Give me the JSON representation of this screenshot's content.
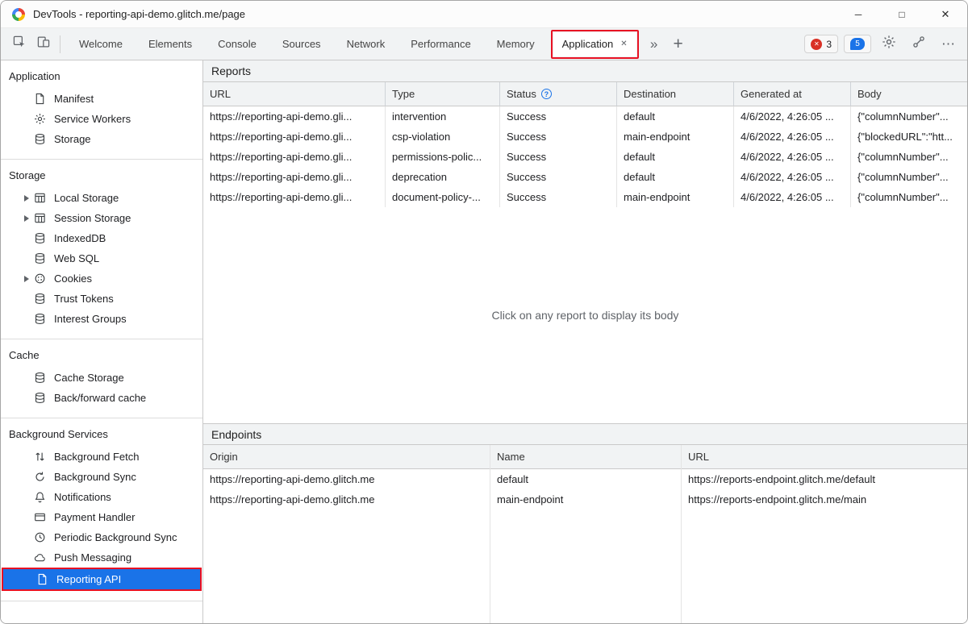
{
  "colors": {
    "selection_blue": "#1a73e8",
    "annotation_red": "#e81123",
    "error_red": "#d93025",
    "issues_blue": "#1a73e8"
  },
  "window": {
    "title": "DevTools - reporting-api-demo.glitch.me/page"
  },
  "toolbar": {
    "tabs": [
      "Welcome",
      "Elements",
      "Console",
      "Sources",
      "Network",
      "Performance",
      "Memory",
      "Application"
    ],
    "active_tab": "Application",
    "error_count": "3",
    "issues_count": "5",
    "icons": [
      "inspect-icon",
      "device-toolbar-icon",
      "overflow-chevron-icon",
      "add-tab-icon",
      "gear-icon",
      "remote-devices-icon",
      "more-menu-icon"
    ]
  },
  "sidebar": {
    "sections": [
      {
        "title": "Application",
        "items": [
          {
            "label": "Manifest",
            "icon": "document-icon"
          },
          {
            "label": "Service Workers",
            "icon": "gear-icon"
          },
          {
            "label": "Storage",
            "icon": "database-icon"
          }
        ]
      },
      {
        "title": "Storage",
        "items": [
          {
            "label": "Local Storage",
            "icon": "table-icon",
            "expandable": true
          },
          {
            "label": "Session Storage",
            "icon": "table-icon",
            "expandable": true
          },
          {
            "label": "IndexedDB",
            "icon": "database-icon"
          },
          {
            "label": "Web SQL",
            "icon": "database-icon"
          },
          {
            "label": "Cookies",
            "icon": "cookie-icon",
            "expandable": true
          },
          {
            "label": "Trust Tokens",
            "icon": "database-icon"
          },
          {
            "label": "Interest Groups",
            "icon": "database-icon"
          }
        ]
      },
      {
        "title": "Cache",
        "items": [
          {
            "label": "Cache Storage",
            "icon": "database-icon"
          },
          {
            "label": "Back/forward cache",
            "icon": "database-icon"
          }
        ]
      },
      {
        "title": "Background Services",
        "items": [
          {
            "label": "Background Fetch",
            "icon": "up-down-arrows-icon"
          },
          {
            "label": "Background Sync",
            "icon": "sync-icon"
          },
          {
            "label": "Notifications",
            "icon": "bell-icon"
          },
          {
            "label": "Payment Handler",
            "icon": "credit-card-icon"
          },
          {
            "label": "Periodic Background Sync",
            "icon": "clock-icon"
          },
          {
            "label": "Push Messaging",
            "icon": "cloud-icon"
          },
          {
            "label": "Reporting API",
            "icon": "document-icon",
            "selected": true
          }
        ]
      }
    ]
  },
  "reports": {
    "title": "Reports",
    "columns": [
      "URL",
      "Type",
      "Status",
      "Destination",
      "Generated at",
      "Body"
    ],
    "status_help_icon": "help-icon",
    "rows": [
      [
        "https://reporting-api-demo.gli...",
        "intervention",
        "Success",
        "default",
        "4/6/2022, 4:26:05 ...",
        "{\"columnNumber\"..."
      ],
      [
        "https://reporting-api-demo.gli...",
        "csp-violation",
        "Success",
        "main-endpoint",
        "4/6/2022, 4:26:05 ...",
        "{\"blockedURL\":\"htt..."
      ],
      [
        "https://reporting-api-demo.gli...",
        "permissions-polic...",
        "Success",
        "default",
        "4/6/2022, 4:26:05 ...",
        "{\"columnNumber\"..."
      ],
      [
        "https://reporting-api-demo.gli...",
        "deprecation",
        "Success",
        "default",
        "4/6/2022, 4:26:05 ...",
        "{\"columnNumber\"..."
      ],
      [
        "https://reporting-api-demo.gli...",
        "document-policy-...",
        "Success",
        "main-endpoint",
        "4/6/2022, 4:26:05 ...",
        "{\"columnNumber\"..."
      ]
    ],
    "placeholder": "Click on any report to display its body"
  },
  "endpoints": {
    "title": "Endpoints",
    "columns": [
      "Origin",
      "Name",
      "URL"
    ],
    "rows": [
      [
        "https://reporting-api-demo.glitch.me",
        "default",
        "https://reports-endpoint.glitch.me/default"
      ],
      [
        "https://reporting-api-demo.glitch.me",
        "main-endpoint",
        "https://reports-endpoint.glitch.me/main"
      ]
    ]
  }
}
